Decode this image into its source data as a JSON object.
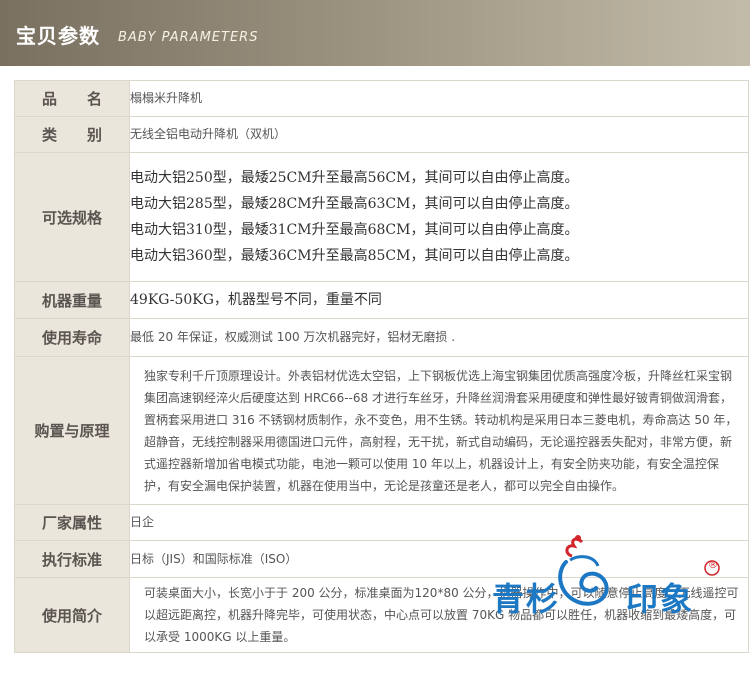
{
  "header": {
    "title": "宝贝参数",
    "subtitle": "BABY PARAMETERS"
  },
  "rows": [
    {
      "label": "品　　名",
      "value": "榻榻米升降机"
    },
    {
      "label": "类　　别",
      "value": "无线全铝电动升降机（双机）"
    },
    {
      "label": "可选规格",
      "lines": [
        "电动大铝250型，最矮25CM升至最高56CM，其间可以自由停止高度。",
        "电动大铝285型，最矮28CM升至最高63CM，其间可以自由停止高度。",
        "电动大铝310型，最矮31CM升至最高68CM，其间可以自由停止高度。",
        "电动大铝360型，最矮36CM升至最高85CM，其间可以自由停止高度。"
      ]
    },
    {
      "label": "机器重量",
      "value": "49KG-50KG，机器型号不同，重量不同"
    },
    {
      "label": "使用寿命",
      "value": "最低 20 年保证，权威测试 100 万次机器完好，铝材无磨损 ."
    },
    {
      "label": "购置与原理",
      "value": "独家专利千斤顶原理设计。外表铝材优选太空铝，上下钢板优选上海宝钢集团优质高强度冷板，升降丝杠采宝钢集团高速钢经淬火后硬度达到 HRC66--68 才进行车丝牙，升降丝润滑套采用硬度和弹性最好铍青铜做润滑套，置柄套采用进口 316 不锈钢材质制作，永不变色，用不生锈。转动机构是采用日本三菱电机，寿命高达 50 年，超静音，无线控制器采用德国进口元件，高射程，无干扰，新式自动编码，无论遥控器丢失配对，非常方便，新式遥控器新增加省电模式功能，电池一颗可以使用 10 年以上，机器设计上，有安全防夹功能，有安全温控保护，有安全漏电保护装置，机器在使用当中，无论是孩童还是老人，都可以完全自由操作。"
    },
    {
      "label": "厂家属性",
      "value": "日企"
    },
    {
      "label": "执行标准",
      "value": "日标（JIS）和国际标准（ISO）"
    },
    {
      "label": "使用简介",
      "value": "可装桌面大小，长宽小于于 200 公分，标准桌面为120*80 公分，机器操作中，可以随意停止高度，无线遥控可以超远距离控，机器升降完毕，可使用状态，中心点可以放置 70KG 物品都可以胜任，机器收缩到最矮高度，可以承受 1000KG 以上重量。"
    }
  ],
  "logo": {
    "left_text": "青杉",
    "right_text": "印象",
    "registered": "®"
  },
  "colors": {
    "header_dark": "#7a7060",
    "label_bg": "#ebe6dc",
    "logo_blue": "#1d78c4",
    "logo_red": "#d2242a"
  }
}
